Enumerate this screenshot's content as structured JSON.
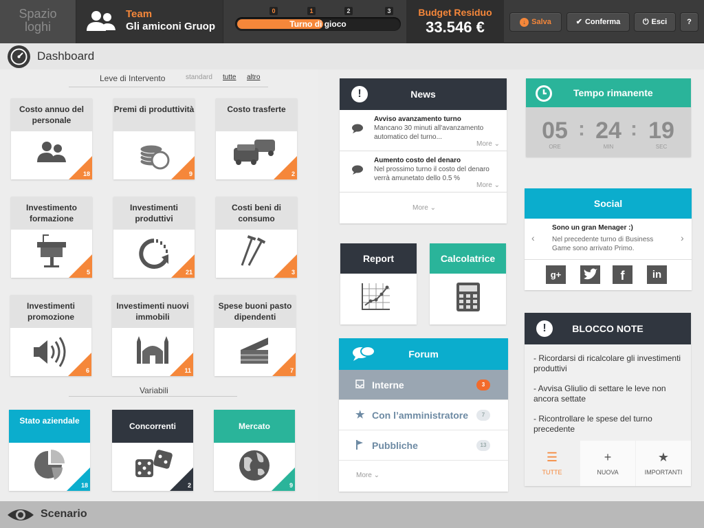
{
  "logo": {
    "line1": "Spazio",
    "line2": "loghi"
  },
  "team": {
    "label": "Team",
    "name": "Gli amiconi Gruop"
  },
  "turn": {
    "ticks": [
      "0",
      "1",
      "2",
      "3"
    ],
    "label": "Turno di gioco",
    "progress": 0.5
  },
  "budget": {
    "label": "Budget Residuo",
    "value": "33.546 €"
  },
  "toolbar": {
    "save": "Salva",
    "confirm": "Conferma",
    "exit": "Esci",
    "help": "?"
  },
  "dashboard": {
    "title": "Dashboard"
  },
  "leve": {
    "title": "Leve di Intervento",
    "filters": [
      "standard",
      "tutte",
      "altro"
    ],
    "cards": [
      {
        "label": "Costo annuo del personale",
        "count": "18",
        "icon": "people-icon"
      },
      {
        "label": "Premi di produttività",
        "count": "9",
        "icon": "coins-icon"
      },
      {
        "label": "Costo trasferte",
        "count": "2",
        "icon": "cars-icon"
      },
      {
        "label": "Investimento formazione",
        "count": "5",
        "icon": "lectern-icon"
      },
      {
        "label": "Investimenti produttivi",
        "count": "21",
        "icon": "refresh-icon"
      },
      {
        "label": "Costi beni di consumo",
        "count": "3",
        "icon": "nails-icon"
      },
      {
        "label": "Investimenti promozione",
        "count": "6",
        "icon": "speaker-icon"
      },
      {
        "label": "Investimenti nuovi immobili",
        "count": "11",
        "icon": "building-icon"
      },
      {
        "label": "Spese buoni pasto dipendenti",
        "count": "7",
        "icon": "cake-icon"
      }
    ]
  },
  "variabili": {
    "title": "Variabili",
    "cards": [
      {
        "label": "Stato aziendale",
        "count": "18",
        "color": "#0badcd",
        "icon": "pie-icon"
      },
      {
        "label": "Concorrenti",
        "count": "2",
        "color": "#30363f",
        "icon": "dice-icon"
      },
      {
        "label": "Mercato",
        "count": "9",
        "color": "#2ab49a",
        "icon": "globe-icon"
      }
    ]
  },
  "news": {
    "title": "News",
    "items": [
      {
        "title": "Avviso avanzamento turno",
        "desc": "Mancano 30 minuti all'avanzamento automatico del turno...",
        "more": "More"
      },
      {
        "title": "Aumento costo del denaro",
        "desc": "Nel prossimo turno il costo del denaro verrà amunetato dello 0.5 %",
        "more": "More"
      }
    ],
    "more": "More"
  },
  "report": {
    "title": "Report"
  },
  "calc": {
    "title": "Calcolatrice"
  },
  "forum": {
    "title": "Forum",
    "rows": [
      {
        "label": "Interne",
        "count": "3"
      },
      {
        "label": "Con l’amministratore",
        "count": "7"
      },
      {
        "label": "Pubbliche",
        "count": "13"
      }
    ],
    "more": "More"
  },
  "timer": {
    "title": "Tempo rimanente",
    "hours": "05",
    "minutes": "24",
    "seconds": "19",
    "units": [
      "ORE",
      "MIN",
      "SEC"
    ]
  },
  "social": {
    "title": "Social",
    "post_title": "Sono un gran Menager :)",
    "post_text": "Nel precedente turno di Business Game sono arrivato Primo.",
    "networks": [
      "g+",
      "twitter",
      "f",
      "in"
    ]
  },
  "notes": {
    "title": "BLOCCO NOTE",
    "items": [
      "- Ricordarsi di ricalcolare gli investimenti produttivi",
      "- Avvisa Gliulio di settare le leve non ancora settate",
      "- Ricontrollare le spese del turno precedente"
    ],
    "tabs": [
      "TUTTE",
      "NUOVA",
      "IMPORTANTI"
    ]
  },
  "scenario": {
    "title": "Scenario"
  },
  "colors": {
    "accent": "#f5873a",
    "dark": "#30363f",
    "teal": "#2ab49a",
    "cyan": "#0badcd"
  }
}
